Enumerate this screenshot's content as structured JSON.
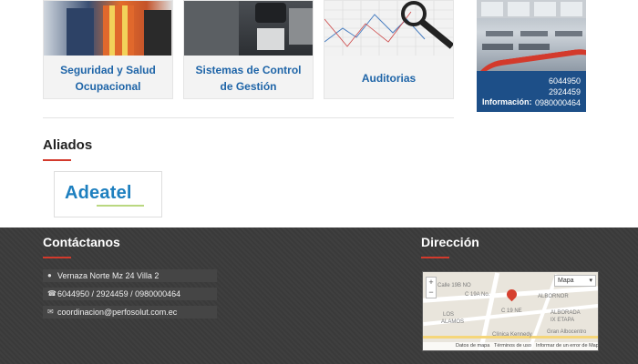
{
  "services": [
    {
      "title": "Seguridad y Salud Ocupacional"
    },
    {
      "title": "Sistemas de Control de Gestión"
    },
    {
      "title": "Auditorias"
    }
  ],
  "banner": {
    "info_label": "Información:",
    "phones": [
      "6044950",
      "2924459",
      "0980000464"
    ]
  },
  "aliados": {
    "title": "Aliados",
    "partner_logo": "Adeatel"
  },
  "footer": {
    "contact_title": "Contáctanos",
    "address": "Vernaza Norte Mz 24 Villa 2",
    "phones": "6044950 / 2924459 / 0980000464",
    "email": "coordinacion@perfosolut.com.ec",
    "direction_title": "Dirección"
  },
  "map": {
    "type_label": "Mapa",
    "labels": [
      "Calle 19B NO",
      "C 19A No.",
      "C 19 NE",
      "ALBORNOR",
      "LOS",
      "ALAMOS",
      "ALBORADA",
      "IX ETAPA",
      "Clínica Kennedy",
      "Gran Albocentro"
    ],
    "attribution": [
      "Datos de mapa",
      "Términos de uso",
      "Informar de un error de Mapa"
    ]
  },
  "colors": {
    "accent_red": "#d33a2c",
    "link_blue": "#1f65a8",
    "footer_bg": "#3b3b3b",
    "banner_blue": "#1d4f88"
  }
}
